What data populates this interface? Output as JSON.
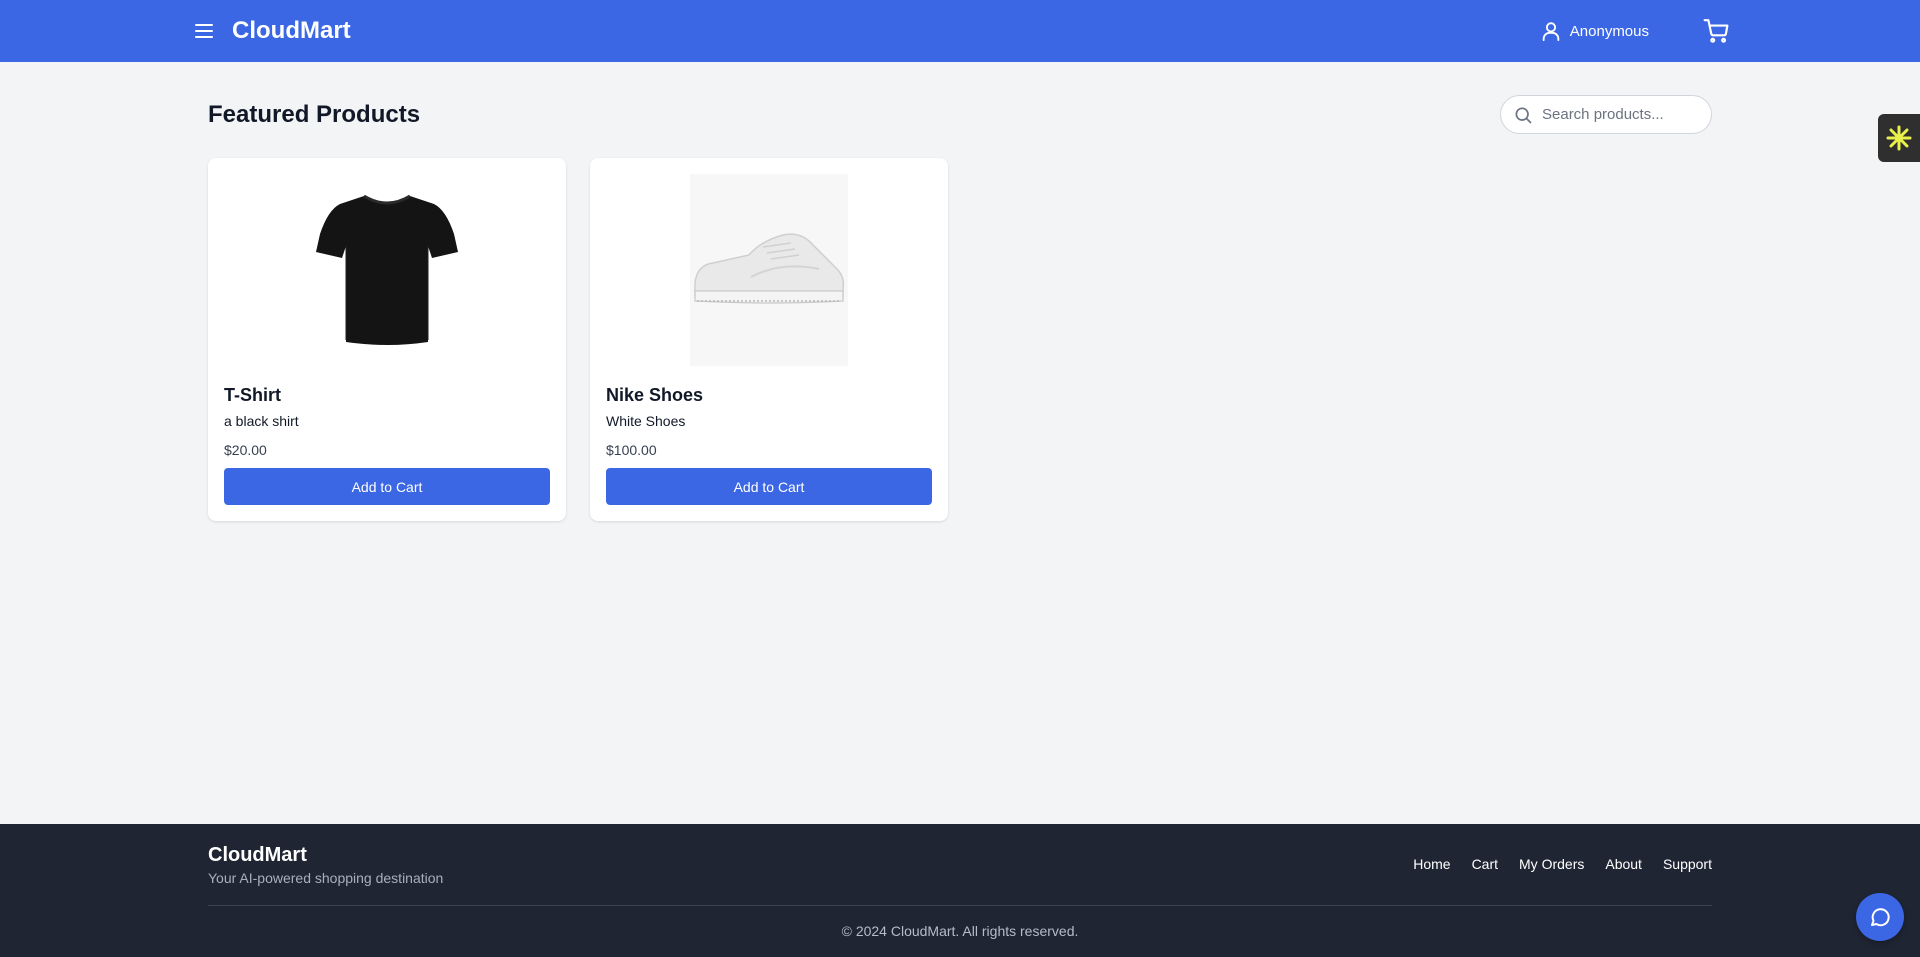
{
  "header": {
    "brand": "CloudMart",
    "user_name": "Anonymous",
    "accent_color": "#3b66e4",
    "icons": [
      "hamburger-menu-icon",
      "user-icon",
      "shopping-cart-icon"
    ]
  },
  "main": {
    "title": "Featured Products",
    "search": {
      "placeholder": "Search products...",
      "value": ""
    },
    "products": [
      {
        "name": "T-Shirt",
        "description": "a black shirt",
        "price": "$20.00",
        "button_label": "Add to Cart",
        "image": "black-tshirt-image"
      },
      {
        "name": "Nike Shoes",
        "description": "White Shoes",
        "price": "$100.00",
        "button_label": "Add to Cart",
        "image": "white-sneaker-image"
      }
    ]
  },
  "footer": {
    "brand": "CloudMart",
    "tagline": "Your AI-powered shopping destination",
    "links": [
      "Home",
      "Cart",
      "My Orders",
      "About",
      "Support"
    ],
    "copyright": "© 2024 CloudMart. All rights reserved."
  },
  "widgets": {
    "side_widget_icon": "asterisk-icon",
    "chat_icon": "chat-bubble-icon"
  }
}
